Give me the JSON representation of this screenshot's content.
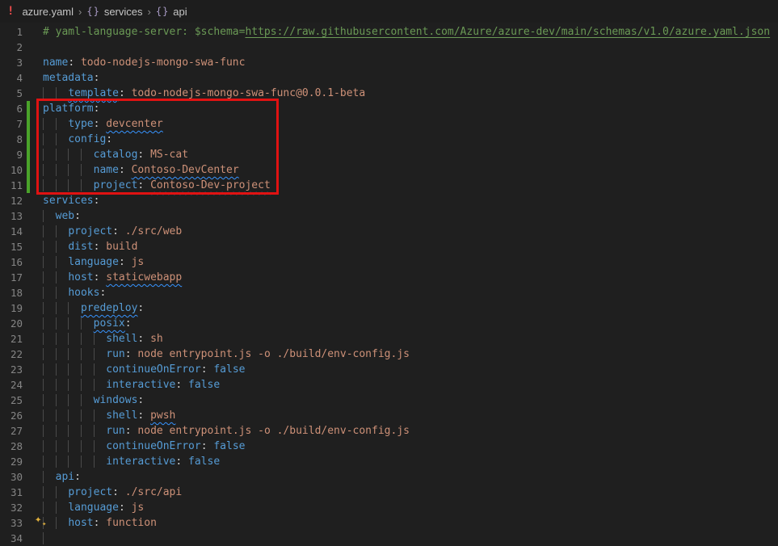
{
  "breadcrumb": {
    "file_error_indicator": "!",
    "file": "azure.yaml",
    "separator": "›",
    "items": [
      {
        "icon": "{}",
        "label": "services"
      },
      {
        "icon": "{}",
        "label": "api"
      }
    ]
  },
  "editor": {
    "language": "yaml",
    "lines": [
      {
        "n": 1,
        "indent": 0,
        "tokens": [
          [
            "comment",
            "# yaml-language-server: $schema="
          ],
          [
            "link",
            "https://raw.githubusercontent.com/Azure/azure-dev/main/schemas/v1.0/azure.yaml.json"
          ]
        ]
      },
      {
        "n": 2,
        "indent": 0,
        "tokens": []
      },
      {
        "n": 3,
        "indent": 0,
        "tokens": [
          [
            "key",
            "name"
          ],
          [
            "punct",
            ":"
          ],
          [
            "val",
            " todo-nodejs-mongo-swa-func"
          ]
        ]
      },
      {
        "n": 4,
        "indent": 0,
        "tokens": [
          [
            "key",
            "metadata"
          ],
          [
            "punct",
            ":"
          ]
        ]
      },
      {
        "n": 5,
        "indent": 4,
        "tokens": [
          [
            "key sq",
            "template"
          ],
          [
            "punct",
            ":"
          ],
          [
            "val",
            " todo-nodejs-mongo-swa-func@0.0.1-beta"
          ]
        ]
      },
      {
        "n": 6,
        "indent": 0,
        "tokens": [
          [
            "key",
            "platform"
          ],
          [
            "punct",
            ":"
          ]
        ]
      },
      {
        "n": 7,
        "indent": 4,
        "tokens": [
          [
            "key",
            "type"
          ],
          [
            "punct",
            ":"
          ],
          [
            "punct",
            " "
          ],
          [
            "val sq",
            "devcenter"
          ]
        ]
      },
      {
        "n": 8,
        "indent": 4,
        "tokens": [
          [
            "key",
            "config"
          ],
          [
            "punct",
            ":"
          ]
        ]
      },
      {
        "n": 9,
        "indent": 8,
        "tokens": [
          [
            "key",
            "catalog"
          ],
          [
            "punct",
            ":"
          ],
          [
            "val",
            " MS-cat"
          ]
        ]
      },
      {
        "n": 10,
        "indent": 8,
        "tokens": [
          [
            "key",
            "name"
          ],
          [
            "punct",
            ":"
          ],
          [
            "punct",
            " "
          ],
          [
            "val sq",
            "Contoso-DevCenter"
          ]
        ]
      },
      {
        "n": 11,
        "indent": 8,
        "tokens": [
          [
            "key",
            "project"
          ],
          [
            "punct",
            ":"
          ],
          [
            "punct",
            " "
          ],
          [
            "val sq",
            "Contoso-Dev-project"
          ]
        ]
      },
      {
        "n": 12,
        "indent": 0,
        "tokens": [
          [
            "key",
            "services"
          ],
          [
            "punct",
            ":"
          ]
        ]
      },
      {
        "n": 13,
        "indent": 2,
        "tokens": [
          [
            "key",
            "web"
          ],
          [
            "punct",
            ":"
          ]
        ]
      },
      {
        "n": 14,
        "indent": 4,
        "tokens": [
          [
            "key",
            "project"
          ],
          [
            "punct",
            ":"
          ],
          [
            "val",
            " ./src/web"
          ]
        ]
      },
      {
        "n": 15,
        "indent": 4,
        "tokens": [
          [
            "key",
            "dist"
          ],
          [
            "punct",
            ":"
          ],
          [
            "val",
            " build"
          ]
        ]
      },
      {
        "n": 16,
        "indent": 4,
        "tokens": [
          [
            "key",
            "language"
          ],
          [
            "punct",
            ":"
          ],
          [
            "val",
            " js"
          ]
        ]
      },
      {
        "n": 17,
        "indent": 4,
        "tokens": [
          [
            "key",
            "host"
          ],
          [
            "punct",
            ":"
          ],
          [
            "punct",
            " "
          ],
          [
            "val sq",
            "staticwebapp"
          ]
        ]
      },
      {
        "n": 18,
        "indent": 4,
        "tokens": [
          [
            "key",
            "hooks"
          ],
          [
            "punct",
            ":"
          ]
        ]
      },
      {
        "n": 19,
        "indent": 6,
        "tokens": [
          [
            "key sq",
            "predeploy"
          ],
          [
            "punct",
            ":"
          ]
        ]
      },
      {
        "n": 20,
        "indent": 8,
        "tokens": [
          [
            "key sq",
            "posix"
          ],
          [
            "punct",
            ":"
          ]
        ]
      },
      {
        "n": 21,
        "indent": 10,
        "tokens": [
          [
            "key",
            "shell"
          ],
          [
            "punct",
            ":"
          ],
          [
            "val",
            " sh"
          ]
        ]
      },
      {
        "n": 22,
        "indent": 10,
        "tokens": [
          [
            "key",
            "run"
          ],
          [
            "punct",
            ":"
          ],
          [
            "val",
            " node entrypoint.js -o ./build/env-config.js"
          ]
        ]
      },
      {
        "n": 23,
        "indent": 10,
        "tokens": [
          [
            "key",
            "continueOnError"
          ],
          [
            "punct",
            ":"
          ],
          [
            "bool",
            " false"
          ]
        ]
      },
      {
        "n": 24,
        "indent": 10,
        "tokens": [
          [
            "key",
            "interactive"
          ],
          [
            "punct",
            ":"
          ],
          [
            "bool",
            " false"
          ]
        ]
      },
      {
        "n": 25,
        "indent": 8,
        "tokens": [
          [
            "key",
            "windows"
          ],
          [
            "punct",
            ":"
          ]
        ]
      },
      {
        "n": 26,
        "indent": 10,
        "tokens": [
          [
            "key",
            "shell"
          ],
          [
            "punct",
            ":"
          ],
          [
            "punct",
            " "
          ],
          [
            "val sq",
            "pwsh"
          ]
        ]
      },
      {
        "n": 27,
        "indent": 10,
        "tokens": [
          [
            "key",
            "run"
          ],
          [
            "punct",
            ":"
          ],
          [
            "val",
            " node entrypoint.js -o ./build/env-config.js"
          ]
        ]
      },
      {
        "n": 28,
        "indent": 10,
        "tokens": [
          [
            "key",
            "continueOnError"
          ],
          [
            "punct",
            ":"
          ],
          [
            "bool",
            " false"
          ]
        ]
      },
      {
        "n": 29,
        "indent": 10,
        "tokens": [
          [
            "key",
            "interactive"
          ],
          [
            "punct",
            ":"
          ],
          [
            "bool",
            " false"
          ]
        ]
      },
      {
        "n": 30,
        "indent": 2,
        "tokens": [
          [
            "key",
            "api"
          ],
          [
            "punct",
            ":"
          ]
        ]
      },
      {
        "n": 31,
        "indent": 4,
        "tokens": [
          [
            "key",
            "project"
          ],
          [
            "punct",
            ":"
          ],
          [
            "val",
            " ./src/api"
          ]
        ]
      },
      {
        "n": 32,
        "indent": 4,
        "tokens": [
          [
            "key",
            "language"
          ],
          [
            "punct",
            ":"
          ],
          [
            "val",
            " js"
          ]
        ]
      },
      {
        "n": 33,
        "indent": 4,
        "tokens": [
          [
            "key",
            "host"
          ],
          [
            "punct",
            ":"
          ],
          [
            "val",
            " function"
          ]
        ]
      },
      {
        "n": 34,
        "indent": 2,
        "tokens": []
      }
    ],
    "decorations": {
      "added_lines_start": 6,
      "added_lines_end": 11,
      "highlight_box_first_line": 6,
      "highlight_box_last_line": 11,
      "sparkle_line": 33,
      "sparkle_glyph": "✦"
    }
  },
  "colors": {
    "bg": "#1f1f1f",
    "bar": "#1d1d1d",
    "key": "#569cd6",
    "val": "#ce9178",
    "comment": "#6a9955",
    "squiggle": "#3794ff",
    "added": "#4aa32a",
    "box": "#e01212",
    "sparkle": "#e2b13c",
    "error": "#f14c4c",
    "symbol": "#a89ac4",
    "linenum": "#858585",
    "guide": "#4a4a4a"
  }
}
